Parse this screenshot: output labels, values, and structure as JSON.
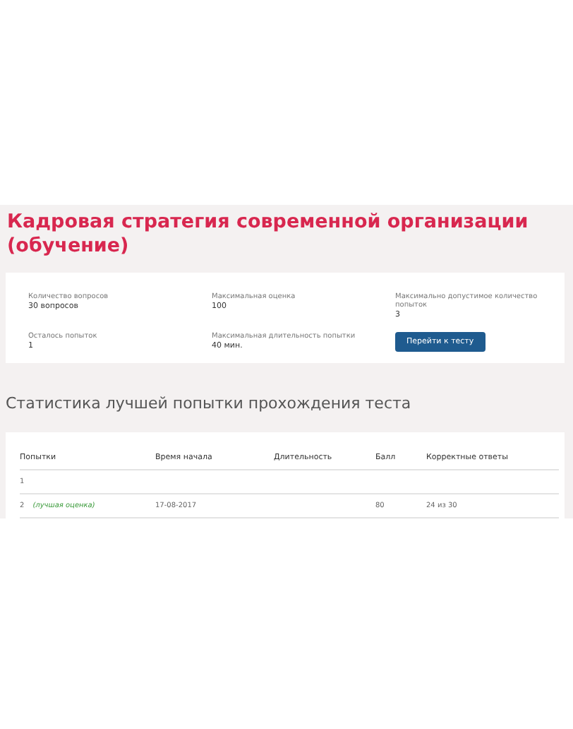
{
  "title": "Кадровая стратегия современной организации (обучение)",
  "info": [
    {
      "label": "Количество вопросов",
      "value": "30 вопросов"
    },
    {
      "label": "Максимальная оценка",
      "value": "100"
    },
    {
      "label": "Максимально допустимое количество попыток",
      "value": "3"
    },
    {
      "label": "Осталось попыток",
      "value": "1"
    },
    {
      "label": "Максимальная длительность попытки",
      "value": "40 мин."
    }
  ],
  "start_button": "Перейти к тесту",
  "stats_title": "Статистика лучшей попытки прохождения теста",
  "table": {
    "columns": [
      "Попытки",
      "Время начала",
      "Длительность",
      "Балл",
      "Корректные ответы"
    ],
    "rows": [
      {
        "cells": [
          "1",
          "",
          "",
          "",
          ""
        ]
      },
      {
        "note": "(лучшая оценка)",
        "cells": [
          "2",
          "17-08-2017",
          "",
          "80",
          "24 из 30"
        ]
      }
    ]
  }
}
